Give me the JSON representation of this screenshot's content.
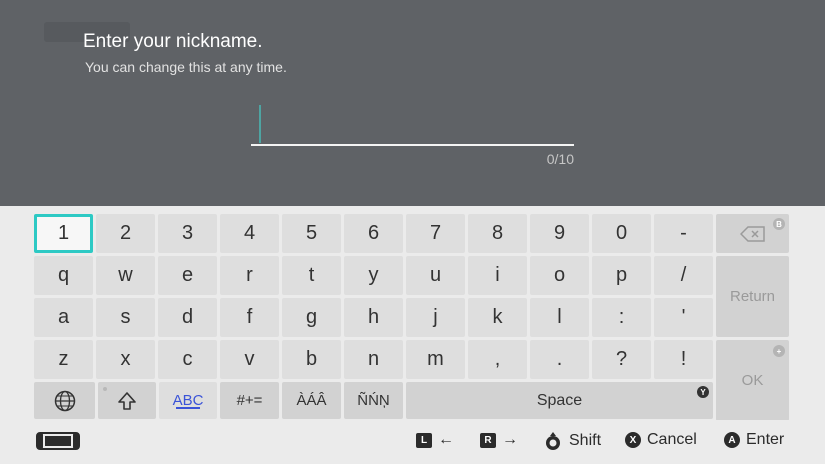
{
  "prompt": {
    "title": "Enter your nickname.",
    "subtitle": "You can change this at any time.",
    "input_value": "",
    "counter": "0/10"
  },
  "keyboard": {
    "row1": [
      "1",
      "2",
      "3",
      "4",
      "5",
      "6",
      "7",
      "8",
      "9",
      "0",
      "-"
    ],
    "row2": [
      "q",
      "w",
      "e",
      "r",
      "t",
      "y",
      "u",
      "i",
      "o",
      "p",
      "/"
    ],
    "row3": [
      "a",
      "s",
      "d",
      "f",
      "g",
      "h",
      "j",
      "k",
      "l",
      ":",
      "'"
    ],
    "row4": [
      "z",
      "x",
      "c",
      "v",
      "b",
      "n",
      "m",
      ",",
      ".",
      "?",
      "!"
    ],
    "backspace_badge": "B",
    "return_label": "Return",
    "ok_label": "OK",
    "ok_badge": "+",
    "mode_abc": "ABC",
    "mode_symbols": "#+=",
    "mode_accents": "ÀÁÂ",
    "mode_accents2": "ÑŃŅ",
    "space_label": "Space",
    "space_badge": "Y"
  },
  "footer": {
    "l_button": "L",
    "r_button": "R",
    "shift_label": "Shift",
    "x_button": "X",
    "cancel_label": "Cancel",
    "a_button": "A",
    "enter_label": "Enter"
  },
  "colors": {
    "header_bg": "#5f6266",
    "keyboard_bg": "#ebebeb",
    "selection": "#2dc9c4",
    "abc_accent": "#3a53d8"
  },
  "icons": {
    "globe": "globe-icon",
    "shift": "shift-arrow-icon",
    "backspace": "backspace-icon",
    "console": "handheld-console-icon",
    "stick": "left-stick-icon"
  }
}
